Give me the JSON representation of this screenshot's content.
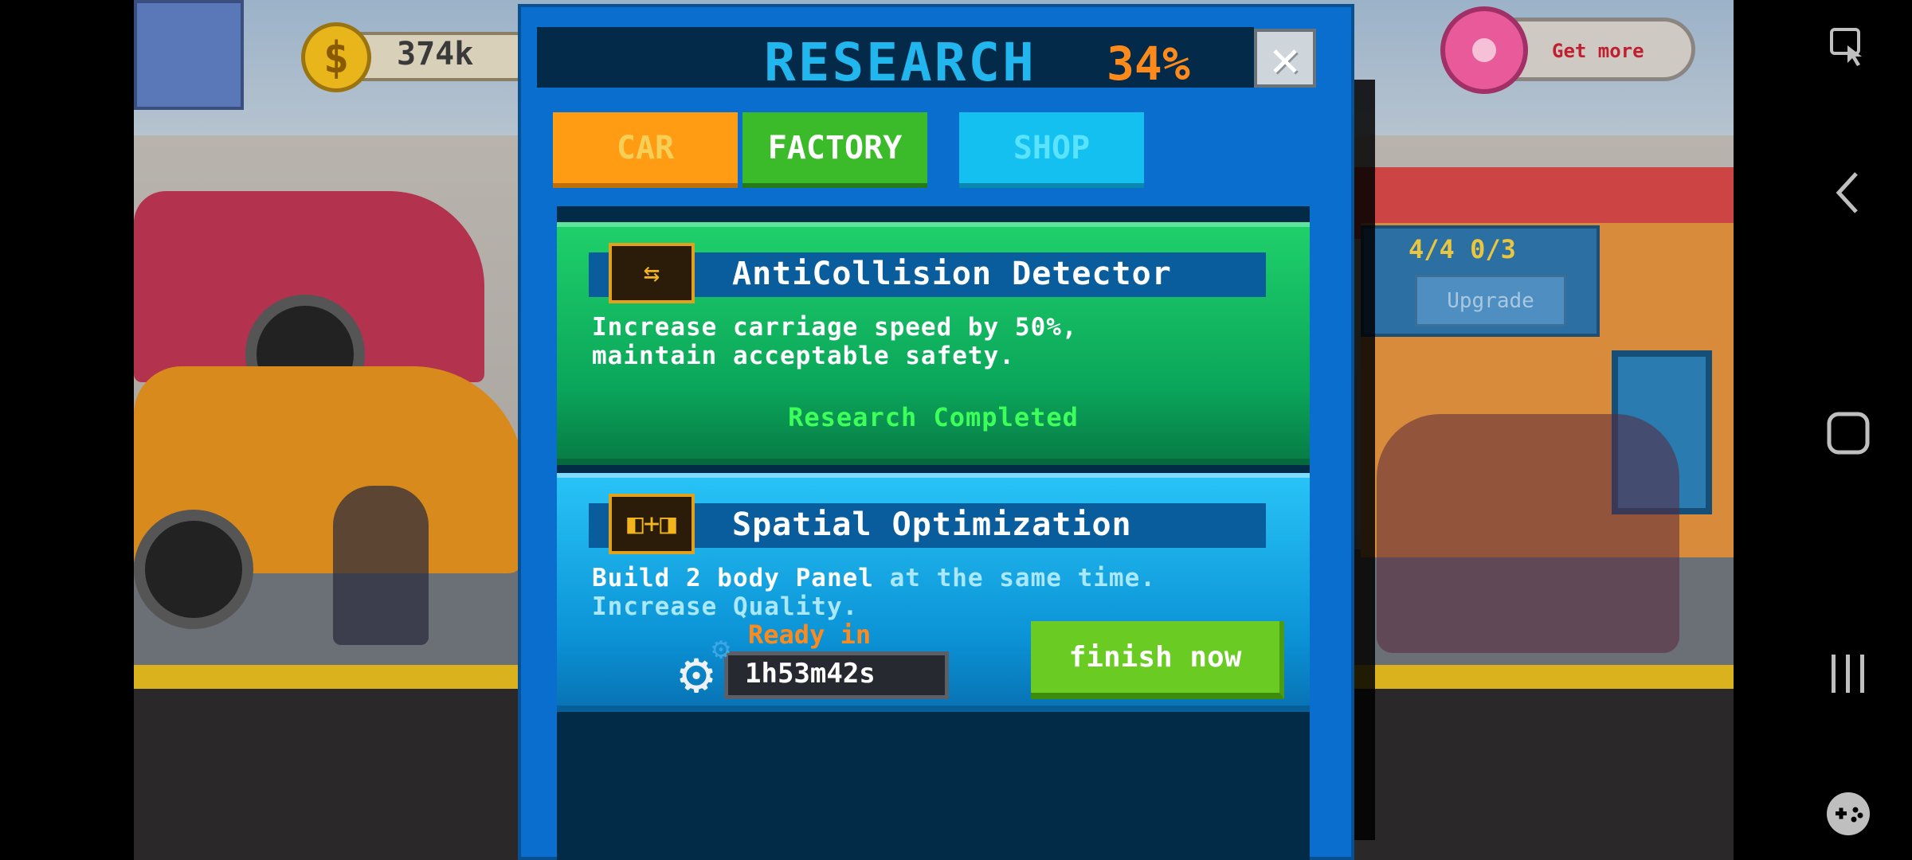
{
  "hud": {
    "coins": "374k",
    "get_more": "Get more",
    "garage_stats": "4/4  0/3",
    "upgrade": "Upgrade"
  },
  "research": {
    "title": "RESEARCH",
    "percent": "34%",
    "tabs": [
      "CAR",
      "FACTORY",
      "SHOP"
    ],
    "items": [
      {
        "title": "AntiCollision Detector",
        "desc_line1": "Increase carriage speed by 50%,",
        "desc_line2": "maintain acceptable safety.",
        "status": "Research Completed"
      },
      {
        "title": "Spatial Optimization",
        "desc_line1_a": "Build 2 body Panel",
        "desc_line1_b": " at the same time.",
        "desc_line2": "Increase Quality.",
        "ready_label": "Ready in",
        "timer": "1h53m42s",
        "finish_label": "finish now"
      }
    ]
  },
  "colors": {
    "panel_blue": "#0a6ecf",
    "title_cyan": "#22b6ee",
    "percent_orange": "#ff8a1c",
    "completed_green": "#3dff5a",
    "finish_green": "#6acb22"
  }
}
